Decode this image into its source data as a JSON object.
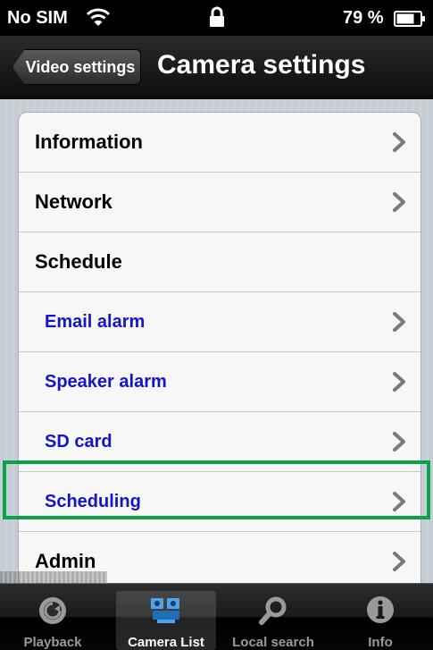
{
  "status_bar": {
    "carrier": "No SIM",
    "battery_percent": "79 %"
  },
  "nav": {
    "back_label": "Video settings",
    "title": "Camera settings"
  },
  "settings": {
    "rows": [
      {
        "label": "Information",
        "sub": false,
        "chevron": true
      },
      {
        "label": "Network",
        "sub": false,
        "chevron": true
      },
      {
        "label": "Schedule",
        "sub": false,
        "chevron": false
      },
      {
        "label": "Email alarm",
        "sub": true,
        "chevron": true
      },
      {
        "label": "Speaker alarm",
        "sub": true,
        "chevron": true
      },
      {
        "label": "SD card",
        "sub": true,
        "chevron": true
      },
      {
        "label": "Scheduling",
        "sub": true,
        "chevron": true,
        "highlighted": true
      },
      {
        "label": "Admin",
        "sub": false,
        "chevron": true
      }
    ]
  },
  "tabs": [
    {
      "label": "Playback",
      "icon": "playback-icon",
      "active": false
    },
    {
      "label": "Camera List",
      "icon": "camera-list-icon",
      "active": true
    },
    {
      "label": "Local search",
      "icon": "search-icon",
      "active": false
    },
    {
      "label": "Info",
      "icon": "info-icon",
      "active": false
    }
  ],
  "colors": {
    "highlight": "#0aa34a",
    "sub_item_text": "#1414c8"
  }
}
